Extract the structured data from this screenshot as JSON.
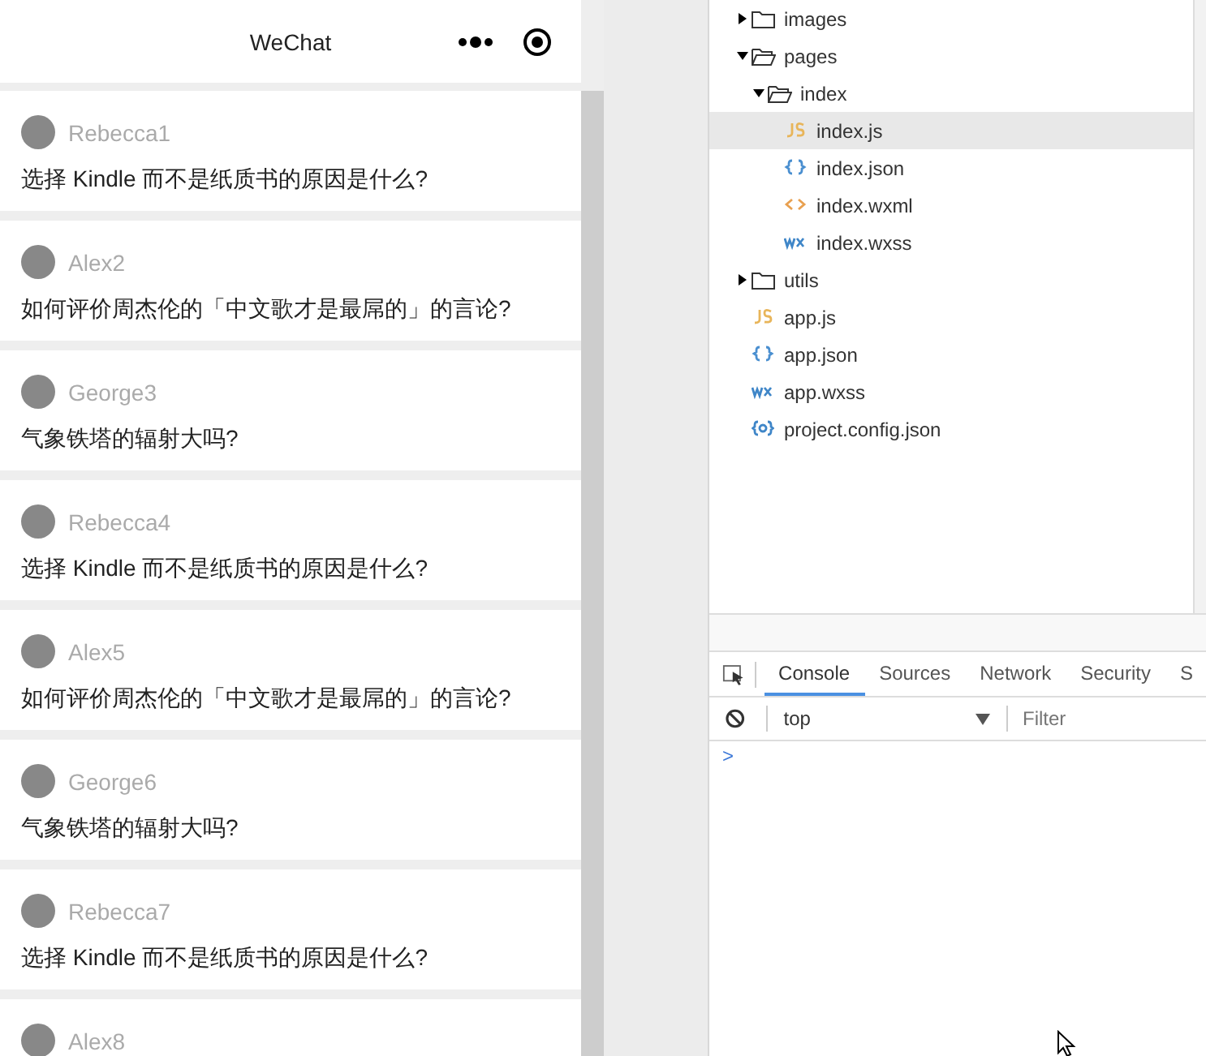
{
  "phone": {
    "title": "WeChat",
    "feed": [
      {
        "author": "Rebecca1",
        "question": "选择 Kindle 而不是纸质书的原因是什么?"
      },
      {
        "author": "Alex2",
        "question": "如何评价周杰伦的「中文歌才是最屌的」的言论?"
      },
      {
        "author": "George3",
        "question": "气象铁塔的辐射大吗?"
      },
      {
        "author": "Rebecca4",
        "question": "选择 Kindle 而不是纸质书的原因是什么?"
      },
      {
        "author": "Alex5",
        "question": "如何评价周杰伦的「中文歌才是最屌的」的言论?"
      },
      {
        "author": "George6",
        "question": "气象铁塔的辐射大吗?"
      },
      {
        "author": "Rebecca7",
        "question": "选择 Kindle 而不是纸质书的原因是什么?"
      },
      {
        "author": "Alex8"
      }
    ]
  },
  "file_tree": [
    {
      "name": "images",
      "kind": "folder",
      "expanded": false,
      "selected": false
    },
    {
      "name": "pages",
      "kind": "folder",
      "expanded": true,
      "selected": false,
      "children": [
        {
          "name": "index",
          "kind": "folder",
          "expanded": true,
          "selected": false,
          "children": [
            {
              "name": "index.js",
              "kind": "js",
              "selected": true
            },
            {
              "name": "index.json",
              "kind": "json",
              "selected": false
            },
            {
              "name": "index.wxml",
              "kind": "wxml",
              "selected": false
            },
            {
              "name": "index.wxss",
              "kind": "wxss",
              "selected": false
            }
          ]
        }
      ]
    },
    {
      "name": "utils",
      "kind": "folder",
      "expanded": false,
      "selected": false
    },
    {
      "name": "app.js",
      "kind": "js",
      "selected": false
    },
    {
      "name": "app.json",
      "kind": "json",
      "selected": false
    },
    {
      "name": "app.wxss",
      "kind": "wxss",
      "selected": false
    },
    {
      "name": "project.config.json",
      "kind": "config",
      "selected": false
    }
  ],
  "devtools": {
    "tabs": [
      {
        "label": "Console",
        "selected": true
      },
      {
        "label": "Sources",
        "selected": false
      },
      {
        "label": "Network",
        "selected": false
      },
      {
        "label": "Security",
        "selected": false
      },
      {
        "label": "S",
        "selected": false
      }
    ],
    "context": "top",
    "filter": {
      "placeholder": "Filter"
    },
    "prompt": ">"
  }
}
